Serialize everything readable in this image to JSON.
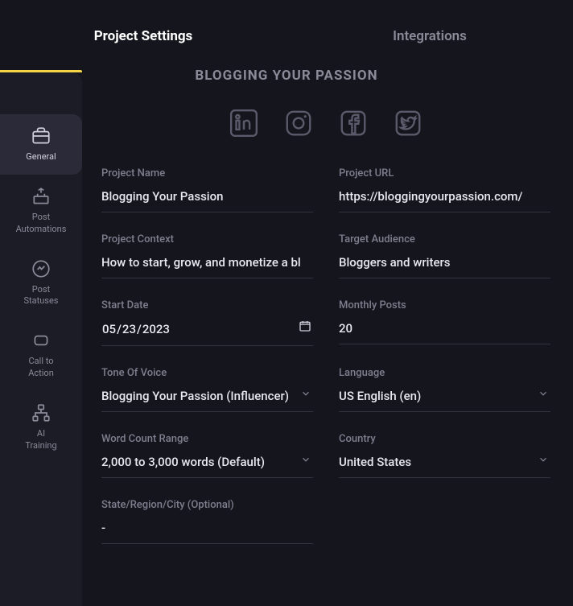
{
  "tabs": {
    "project_settings": "Project Settings",
    "integrations": "Integrations"
  },
  "banner": "BLOGGING YOUR PASSION",
  "sidebar": {
    "general": "General",
    "post_automations": "Post\nAutomations",
    "post_statuses": "Post\nStatuses",
    "call_to_action": "Call to\nAction",
    "ai_training": "AI\nTraining"
  },
  "labels": {
    "project_name": "Project Name",
    "project_url": "Project URL",
    "project_context": "Project Context",
    "target_audience": "Target Audience",
    "start_date": "Start Date",
    "monthly_posts": "Monthly Posts",
    "tone_of_voice": "Tone Of Voice",
    "language": "Language",
    "word_count_range": "Word Count Range",
    "country": "Country",
    "state_region_city": "State/Region/City (Optional)"
  },
  "values": {
    "project_name": "Blogging Your Passion",
    "project_url": "https://bloggingyourpassion.com/",
    "project_context": "How to start, grow, and monetize a bl",
    "target_audience": "Bloggers and writers",
    "start_date_display": "05/23/2023",
    "start_date_iso": "2023-05-23",
    "monthly_posts": "20",
    "tone_of_voice": "Blogging Your Passion (Influencer)",
    "language": "US English (en)",
    "word_count_range": "2,000 to 3,000 words (Default)",
    "country": "United States",
    "state_region_city": "-"
  }
}
